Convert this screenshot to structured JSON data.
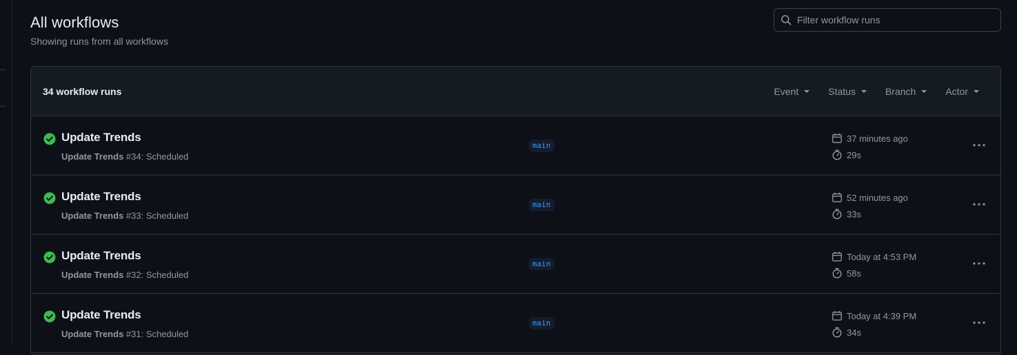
{
  "header": {
    "title": "All workflows",
    "subtitle": "Showing runs from all workflows",
    "filter_placeholder": "Filter workflow runs"
  },
  "runs_header": {
    "count_label": "34 workflow runs",
    "filters": [
      "Event",
      "Status",
      "Branch",
      "Actor"
    ]
  },
  "colors": {
    "success": "#3fb950",
    "branch_text": "#4493f8",
    "muted": "#9198a1"
  },
  "runs": [
    {
      "title": "Update Trends",
      "workflow": "Update Trends",
      "run_number": "#34",
      "trigger": ": Scheduled",
      "branch": "main",
      "when": "37 minutes ago",
      "duration": "29s",
      "status_icon": "check-circle-icon"
    },
    {
      "title": "Update Trends",
      "workflow": "Update Trends",
      "run_number": "#33",
      "trigger": ": Scheduled",
      "branch": "main",
      "when": "52 minutes ago",
      "duration": "33s",
      "status_icon": "check-circle-icon"
    },
    {
      "title": "Update Trends",
      "workflow": "Update Trends",
      "run_number": "#32",
      "trigger": ": Scheduled",
      "branch": "main",
      "when": "Today at 4:53 PM",
      "duration": "58s",
      "status_icon": "check-circle-icon"
    },
    {
      "title": "Update Trends",
      "workflow": "Update Trends",
      "run_number": "#31",
      "trigger": ": Scheduled",
      "branch": "main",
      "when": "Today at 4:39 PM",
      "duration": "34s",
      "status_icon": "check-circle-icon"
    }
  ]
}
